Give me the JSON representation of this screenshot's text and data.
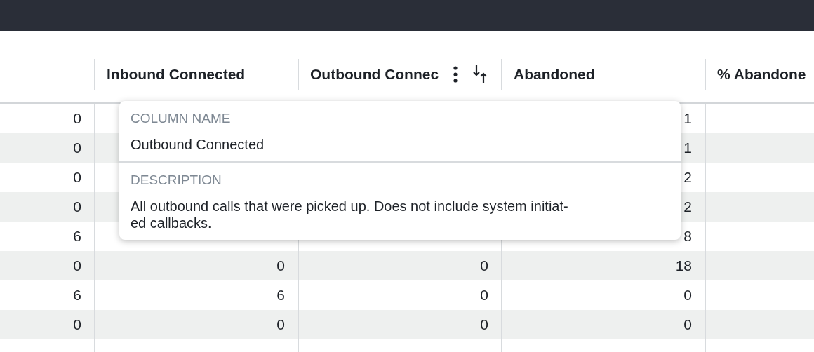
{
  "table": {
    "columns": [
      {},
      {
        "label": "Inbound Connected",
        "menu": false,
        "sort": false
      },
      {
        "label": "Outbound Connec",
        "menu": true,
        "sort": true
      },
      {
        "label": "Abandoned",
        "menu": false,
        "sort": false
      },
      {
        "label": "% Abandone"
      }
    ],
    "rows": [
      {
        "cells": [
          "0",
          null,
          null,
          "1",
          null
        ]
      },
      {
        "cells": [
          "0",
          null,
          null,
          "1",
          null
        ]
      },
      {
        "cells": [
          "0",
          null,
          null,
          "2",
          null
        ]
      },
      {
        "cells": [
          "0",
          null,
          null,
          "2",
          null
        ]
      },
      {
        "cells": [
          "6",
          null,
          null,
          "8",
          null
        ]
      },
      {
        "cells": [
          "0",
          "0",
          "0",
          "18",
          null
        ]
      },
      {
        "cells": [
          "6",
          "6",
          "0",
          "0",
          null
        ]
      },
      {
        "cells": [
          "0",
          "0",
          "0",
          "0",
          null
        ]
      },
      {
        "cells": [
          null,
          null,
          null,
          null,
          null
        ]
      }
    ]
  },
  "popover": {
    "name_heading": "COLUMN NAME",
    "name": "Outbound Connected",
    "description_heading": "DESCRIPTION",
    "description_lines": [
      "All outbound calls that were picked up. Does not include system initiat-",
      "ed callbacks."
    ]
  }
}
